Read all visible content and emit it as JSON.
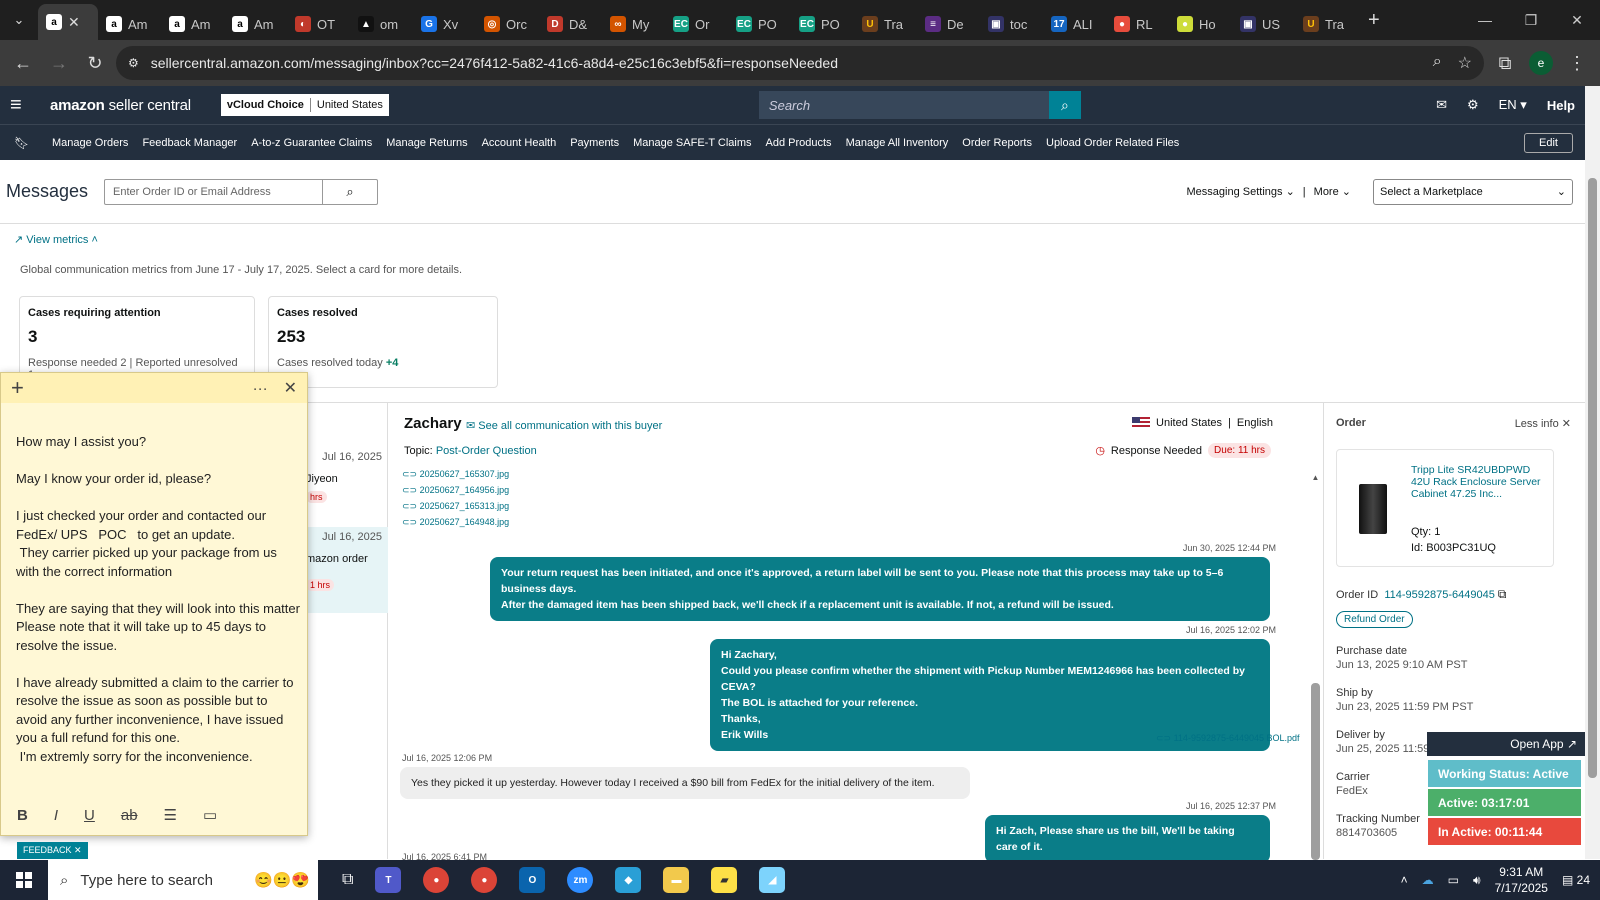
{
  "browser": {
    "tabs": [
      {
        "label": "",
        "fav": "a",
        "color": "#ffffff",
        "fg": "#000",
        "active": true
      },
      {
        "label": "Am",
        "fav": "a",
        "color": "#ffffff",
        "fg": "#000"
      },
      {
        "label": "Am",
        "fav": "a",
        "color": "#ffffff",
        "fg": "#000"
      },
      {
        "label": "Am",
        "fav": "a",
        "color": "#ffffff",
        "fg": "#000"
      },
      {
        "label": "OT",
        "fav": "◐",
        "color": "#c0392b",
        "fg": "#fff"
      },
      {
        "label": "om",
        "fav": "▲",
        "color": "#111111",
        "fg": "#fff"
      },
      {
        "label": "Xv",
        "fav": "G",
        "color": "#1a73e8",
        "fg": "#fff"
      },
      {
        "label": "Orc",
        "fav": "◎",
        "color": "#d35400",
        "fg": "#fff"
      },
      {
        "label": "D&",
        "fav": "D",
        "color": "#c0392b",
        "fg": "#fff"
      },
      {
        "label": "My",
        "fav": "∞",
        "color": "#d35400",
        "fg": "#fff"
      },
      {
        "label": "Or",
        "fav": "EC",
        "color": "#16a085",
        "fg": "#fff"
      },
      {
        "label": "PO",
        "fav": "EC",
        "color": "#16a085",
        "fg": "#fff"
      },
      {
        "label": "PO",
        "fav": "EC",
        "color": "#16a085",
        "fg": "#fff"
      },
      {
        "label": "Tra",
        "fav": "U",
        "color": "#6b3e1d",
        "fg": "#ffc107"
      },
      {
        "label": "De",
        "fav": "≡",
        "color": "#5b2c83",
        "fg": "#fff"
      },
      {
        "label": "toc",
        "fav": "▣",
        "color": "#333366",
        "fg": "#fff"
      },
      {
        "label": "ALI",
        "fav": "17",
        "color": "#1565c0",
        "fg": "#fff"
      },
      {
        "label": "RL",
        "fav": "●",
        "color": "#e74c3c",
        "fg": "#fff"
      },
      {
        "label": "Ho",
        "fav": "●",
        "color": "#cddc39",
        "fg": "#fff"
      },
      {
        "label": "US",
        "fav": "▣",
        "color": "#333366",
        "fg": "#fff"
      },
      {
        "label": "Tra",
        "fav": "U",
        "color": "#6b3e1d",
        "fg": "#ffc107"
      }
    ],
    "url": "sellercentral.amazon.com/messaging/inbox?cc=2476f412-5a82-41c6-a8d4-e25c16c3ebf5&fi=responseNeeded",
    "profile_initial": "e"
  },
  "header": {
    "logo_bold": "amazon",
    "logo_light": " seller central",
    "account_name": "vCloud Choice",
    "account_region": "United States",
    "search_placeholder": "Search",
    "lang": "EN",
    "help": "Help"
  },
  "navlinks": [
    "Manage Orders",
    "Feedback Manager",
    "A-to-z Guarantee Claims",
    "Manage Returns",
    "Account Health",
    "Payments",
    "Manage SAFE-T Claims",
    "Add Products",
    "Manage All Inventory",
    "Order Reports",
    "Upload Order Related Files"
  ],
  "edit_label": "Edit",
  "messages": {
    "title": "Messages",
    "search_placeholder": "Enter Order ID or Email Address",
    "settings": "Messaging Settings",
    "more": "More",
    "marketplace": "Select a Marketplace",
    "view_metrics": "View metrics",
    "metrics_sub": "Global communication metrics from June 17 - July 17, 2025. Select a card for more details."
  },
  "cards": [
    {
      "title": "Cases requiring attention",
      "value": "3",
      "sub": "Response needed 2 | Reported unresolved 1"
    },
    {
      "title": "Cases resolved",
      "value": "253",
      "sub": "Cases resolved today",
      "plus": "+4"
    }
  ],
  "list": [
    {
      "date": "Jul 16, 2025",
      "name": "Jiyeon",
      "pill": "hrs"
    },
    {
      "date": "Jul 16, 2025",
      "name": "mazon order",
      "pill": "1 hrs"
    }
  ],
  "conversation": {
    "buyer": "Zachary",
    "see_all": "See all communication with this buyer",
    "topic_label": "Topic:",
    "topic": "Post-Order Question",
    "country": "United States",
    "language": "English",
    "response_needed": "Response Needed",
    "due": "Due: 11 hrs",
    "attachments": [
      "20250627_165307.jpg",
      "20250627_164956.jpg",
      "20250627_165313.jpg",
      "20250627_164948.jpg"
    ],
    "ts1": "Jun 30, 2025 12:44 PM",
    "msg1": "Your return request has been initiated, and once it's approved, a return label will be sent to you. Please note that this process may take up to 5–6 business days.\nAfter the damaged item has been shipped back, we'll check if a replacement unit is available. If not, a refund will be issued.",
    "ts2": "Jul 16, 2025 12:02 PM",
    "msg2": "Hi Zachary,\nCould you please confirm whether the shipment with Pickup Number MEM1246966 has been collected by CEVA?\nThe BOL is attached for your reference.\nThanks,\nErik Wills",
    "pdf": "114-9592875-6449045 BOL.pdf",
    "ts3": "Jul 16, 2025 12:06 PM",
    "msg3": "Yes they picked it up yesterday. However today I received a $90 bill from FedEx for the initial delivery of the item.",
    "ts4": "Jul 16, 2025 12:37 PM",
    "msg4": "Hi Zach, Please share us the bill, We'll be taking care of it.",
    "ts5": "Jul 16, 2025 6:41 PM"
  },
  "order": {
    "title": "Order",
    "less_info": "Less info",
    "product": "Tripp Lite SR42UBDPWD 42U Rack Enclosure Server Cabinet 47.25 Inc...",
    "qty": "Qty: 1",
    "id": "Id: B003PC31UQ",
    "order_id_label": "Order ID",
    "order_id": "114-9592875-6449045",
    "refund": "Refund Order",
    "purchase_label": "Purchase date",
    "purchase": "Jun 13, 2025 9:10 AM PST",
    "shipby_label": "Ship by",
    "shipby": "Jun 23, 2025 11:59 PM PST",
    "deliverby_label": "Deliver by",
    "deliverby": "Jun 25, 2025 11:59 PM PST",
    "carrier_label": "Carrier",
    "carrier": "FedEx",
    "tracking_label": "Tracking Number",
    "tracking": "8814703605"
  },
  "sticky": {
    "text": "How may I assist you?\n\nMay I know your order id, please?\n\nI just checked your order and contacted our FedEx/ UPS   POC   to get an update.\n They carrier picked up your package from us with the correct information\n\nThey are saying that they will look into this matter Please note that it will take up to 45 days to resolve the issue.\n\nI have already submitted a claim to the carrier to resolve the issue as soon as possible but to avoid any further inconvenience, I have issued you a full refund for this one.\n I'm extremly sorry for the inconvenience."
  },
  "feedback": "FEEDBACK",
  "status_widget": {
    "open_app": "Open App",
    "working": "Working Status: Active",
    "active": "Active: 03:17:01",
    "inactive": "In Active: 00:11:44",
    "colors": {
      "working": "#5fbdc9",
      "active": "#4caf6a",
      "inactive": "#e8493d"
    }
  },
  "taskbar": {
    "search_placeholder": "Type here to search",
    "time": "9:31 AM",
    "date": "7/17/2025",
    "notif": "24"
  }
}
